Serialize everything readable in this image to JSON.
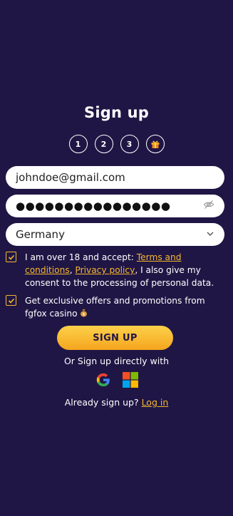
{
  "header": {
    "title": "Sign up"
  },
  "steps": [
    {
      "label": "1"
    },
    {
      "label": "2"
    },
    {
      "label": "3"
    },
    {
      "icon": "gift-icon"
    }
  ],
  "form": {
    "email": {
      "value": "johndoe@gmail.com"
    },
    "password": {
      "masked_value": "●●●●●●●●●●●●●●●●",
      "icon": "eye-slash-icon"
    },
    "country": {
      "value": "Germany",
      "icon": "chevron-down-icon"
    }
  },
  "consent": {
    "terms_checked": true,
    "terms_prefix": "I am over 18 and accept: ",
    "terms_link": "Terms and conditions",
    "separator": ", ",
    "privacy_link": "Privacy policy",
    "terms_suffix": ", I also give my consent to the processing of personal data.",
    "offers_checked": true,
    "offers_text": "Get exclusive offers and promotions from fgfox casino",
    "offers_icon": "money-bag-icon"
  },
  "actions": {
    "signup_label": "SIGN UP",
    "or_text": "Or Sign up directly with",
    "socials": [
      "google-icon",
      "microsoft-icon"
    ],
    "already_text": "Already sign up? ",
    "login_link": "Log in"
  },
  "colors": {
    "background": "#201645",
    "accent": "#f5b82e",
    "button_gradient_top": "#fdd14a",
    "button_gradient_bottom": "#f5a51e"
  }
}
